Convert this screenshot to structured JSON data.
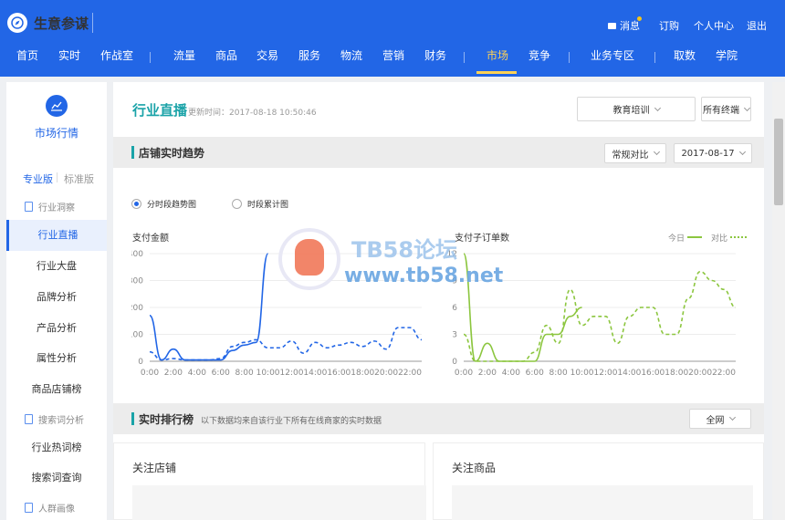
{
  "app": {
    "name": "生意参谋"
  },
  "util": {
    "msg": "消息",
    "subscribe": "订购",
    "personal": "个人中心",
    "logout": "退出"
  },
  "nav": [
    "首页",
    "实时",
    "作战室",
    "流量",
    "商品",
    "交易",
    "服务",
    "物流",
    "营销",
    "财务",
    "市场",
    "竞争",
    "业务专区",
    "取数",
    "学院"
  ],
  "nav_active": "市场",
  "sidebar": {
    "title": "市场行情",
    "tab_pro": "专业版",
    "tab_std": "标准版",
    "sec1": "行业洞察",
    "items1": [
      "行业直播",
      "行业大盘",
      "品牌分析",
      "产品分析",
      "属性分析",
      "商品店铺榜"
    ],
    "sec2": "搜索词分析",
    "items2": [
      "行业热词榜",
      "搜索词查询"
    ],
    "sec3": "人群画像"
  },
  "main": {
    "title": "行业直播",
    "update": "更新时间：2017-08-18 10:50:46",
    "dd_industry": "教育培训",
    "dd_terminal": "所有终端"
  },
  "trend": {
    "title": "店铺实时趋势",
    "dd_compare": "常规对比",
    "dd_date": "2017-08-17",
    "radio1": "分时段趋势图",
    "radio2": "时段累计图",
    "legend_today": "今日",
    "legend_compare": "对比"
  },
  "rank": {
    "title": "实时排行榜",
    "desc": "以下数据均来自该行业下所有在线商家的实时数据",
    "dd_net": "全网",
    "card1": "关注店铺",
    "card2": "关注商品"
  },
  "watermark": {
    "title": "TB58论坛",
    "url": "www.tb58.net"
  },
  "colors": {
    "brand": "#2266e6",
    "accent": "#1aa3a8",
    "nav_active": "#ffd256",
    "green": "#8cc63f"
  },
  "chart_data": [
    {
      "type": "line",
      "title": "支付金额",
      "xticks": [
        "0:00",
        "2:00",
        "4:00",
        "6:00",
        "8:00",
        "10:00",
        "12:00",
        "14:00",
        "16:00",
        "18:00",
        "20:00",
        "22:00"
      ],
      "yticks": [
        0,
        100,
        200,
        300,
        400
      ],
      "ylim": [
        0,
        400
      ],
      "series": [
        {
          "name": "今日",
          "style": "solid",
          "color": "#2266e6",
          "x": [
            0,
            1,
            2,
            3,
            4,
            5,
            6,
            7,
            8,
            9,
            10
          ],
          "y": [
            170,
            5,
            45,
            5,
            5,
            5,
            5,
            40,
            60,
            70,
            400
          ]
        },
        {
          "name": "对比",
          "style": "dashed",
          "color": "#2266e6",
          "x": [
            0,
            1,
            2,
            3,
            4,
            5,
            6,
            7,
            8,
            9,
            10,
            11,
            12,
            13,
            14,
            15,
            16,
            17,
            18,
            19,
            20,
            21,
            22,
            23
          ],
          "y": [
            35,
            5,
            10,
            5,
            5,
            5,
            10,
            55,
            70,
            80,
            50,
            50,
            75,
            30,
            70,
            50,
            60,
            70,
            55,
            75,
            45,
            125,
            125,
            80
          ]
        }
      ]
    },
    {
      "type": "line",
      "title": "支付子订单数",
      "xticks": [
        "0:00",
        "2:00",
        "4:00",
        "6:00",
        "8:00",
        "10:00",
        "12:00",
        "14:00",
        "16:00",
        "18:00",
        "20:00",
        "22:00"
      ],
      "yticks": [
        0,
        3,
        6,
        9,
        12
      ],
      "ylim": [
        0,
        12
      ],
      "series": [
        {
          "name": "今日",
          "style": "solid",
          "color": "#8cc63f",
          "x": [
            0,
            1,
            2,
            3,
            4,
            5,
            6,
            7,
            8,
            9,
            10
          ],
          "y": [
            12,
            0,
            2,
            0,
            0,
            0,
            0,
            3,
            3,
            5,
            6
          ]
        },
        {
          "name": "对比",
          "style": "dashed",
          "color": "#8cc63f",
          "x": [
            0,
            1,
            2,
            3,
            4,
            5,
            6,
            7,
            8,
            9,
            10,
            11,
            12,
            13,
            14,
            15,
            16,
            17,
            18,
            19,
            20,
            21,
            22,
            23
          ],
          "y": [
            3,
            0,
            0,
            0,
            0,
            0,
            1,
            4,
            2,
            8,
            4,
            5,
            5,
            2,
            5,
            6,
            6,
            3,
            3,
            7,
            10,
            9,
            8,
            6
          ]
        }
      ]
    }
  ]
}
